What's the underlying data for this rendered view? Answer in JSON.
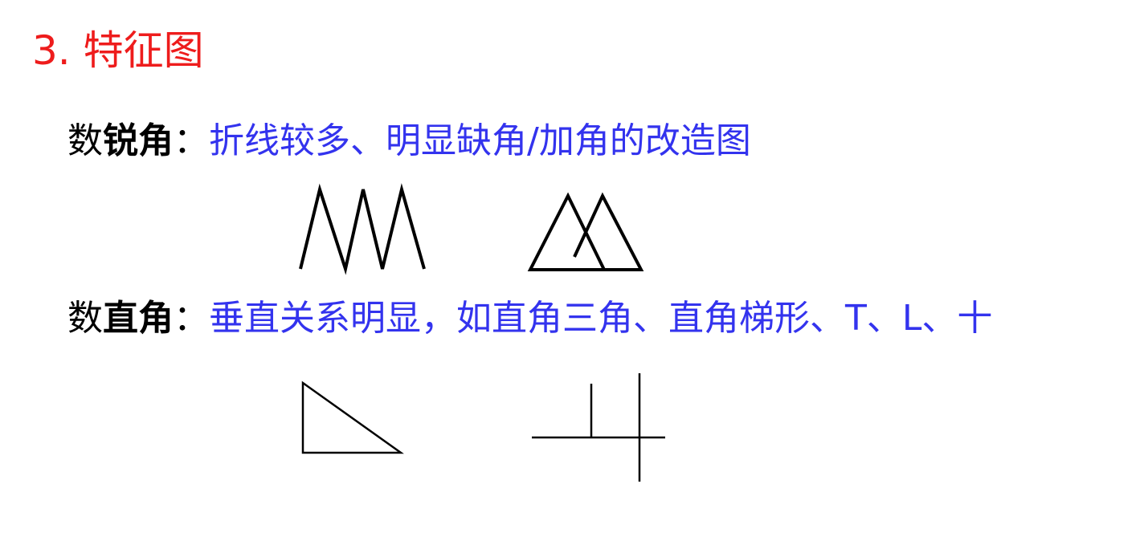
{
  "heading": "3. 特征图",
  "items": [
    {
      "prefix": "数",
      "keyword": "锐角",
      "colon": "：",
      "description": "折线较多、明显缺角/加角的改造图"
    },
    {
      "prefix": "数",
      "keyword": "直角",
      "colon": "：",
      "description": "垂直关系明显，如直角三角、直角梯形、T、L、十"
    }
  ],
  "figures": {
    "acute": [
      "zigzag-figure",
      "overlapping-triangles-figure"
    ],
    "right": [
      "right-triangle-figure",
      "perpendicular-lines-figure"
    ]
  }
}
